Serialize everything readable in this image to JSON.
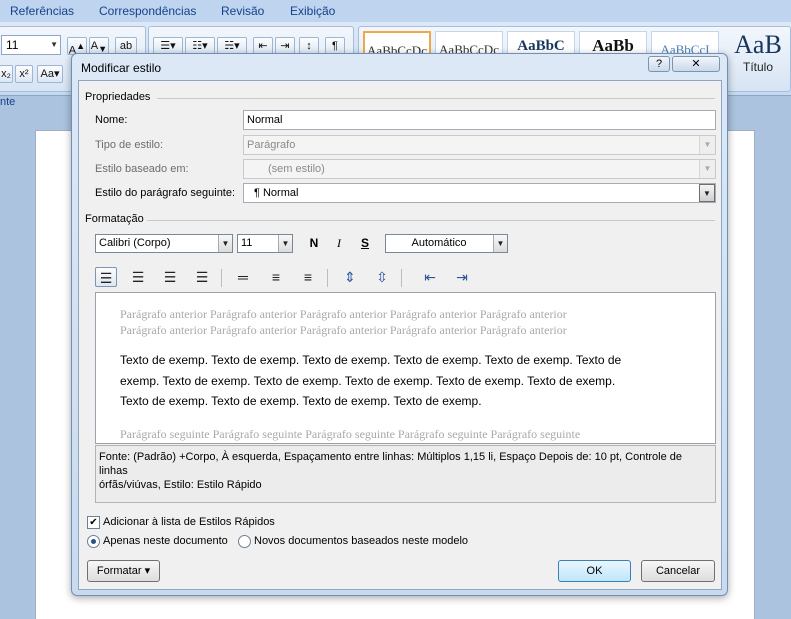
{
  "ribbon": {
    "tabs": [
      "Referências",
      "Correspondências",
      "Revisão",
      "Exibição"
    ],
    "font_size": "11",
    "quick_styles": [
      "AaBbCcDc",
      "AaBbCcDc",
      "AaBbC",
      "AaBb",
      "AaBbCcI"
    ],
    "title_style_preview": "AaB",
    "title_style_label": "Título",
    "side_label": "nte"
  },
  "dialog": {
    "title": "Modificar estilo",
    "help": "?",
    "close": "✕",
    "properties": {
      "section": "Propriedades",
      "name_label": "Nome:",
      "name_value": "Normal",
      "type_label": "Tipo de estilo:",
      "type_value": "Parágrafo",
      "based_label": "Estilo baseado em:",
      "based_value": "(sem estilo)",
      "next_label": "Estilo do parágrafo seguinte:",
      "next_value": "¶ Normal"
    },
    "formatting": {
      "section": "Formatação",
      "font": "Calibri (Corpo)",
      "size": "11",
      "bold": "N",
      "italic": "I",
      "underline": "S",
      "color": "Automático"
    },
    "preview": {
      "previous_lines": [
        "Parágrafo anterior Parágrafo anterior Parágrafo anterior Parágrafo anterior Parágrafo anterior",
        "Parágrafo anterior Parágrafo anterior Parágrafo anterior Parágrafo anterior Parágrafo anterior"
      ],
      "sample_lines": [
        "Texto de exemp. Texto de exemp. Texto de exemp. Texto de exemp. Texto de exemp. Texto de",
        "exemp. Texto de exemp. Texto de exemp. Texto de exemp. Texto de exemp. Texto de exemp.",
        "Texto de exemp. Texto de exemp. Texto de exemp. Texto de exemp."
      ],
      "next_line": "Parágrafo seguinte Parágrafo seguinte Parágrafo seguinte Parágrafo seguinte Parágrafo seguinte"
    },
    "description_lines": [
      "Fonte: (Padrão) +Corpo, À esquerda, Espaçamento entre linhas:  Múltiplos 1,15 li, Espaço Depois de:  10 pt, Controle de linhas",
      "órfãs/viúvas, Estilo: Estilo Rápido"
    ],
    "add_quick_styles": "Adicionar à lista de Estilos Rápidos",
    "only_this_document": "Apenas neste documento",
    "new_documents": "Novos documentos baseados neste modelo",
    "format_button": "Formatar ▾",
    "ok": "OK",
    "cancel": "Cancelar"
  }
}
